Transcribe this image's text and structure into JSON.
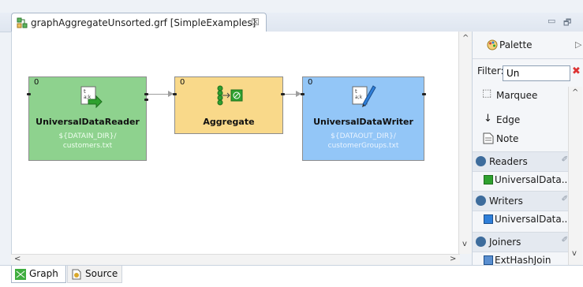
{
  "editor": {
    "tab_title": "graphAggregateUnsorted.grf [SimpleExamples]",
    "tab_close": "☒",
    "minimize": "▭",
    "maximize": "🗗"
  },
  "graph": {
    "reader": {
      "index": "0",
      "title": "UniversalDataReader",
      "sub1": "${DATAIN_DIR}/",
      "sub2": "customers.txt",
      "color": "#8ed28e"
    },
    "aggregate": {
      "index": "0",
      "title": "Aggregate",
      "color": "#f9d98a"
    },
    "writer": {
      "index": "0",
      "title": "UniversalDataWriter",
      "sub1": "${DATAOUT_DIR}/",
      "sub2": "customerGroups.txt",
      "color": "#93c6f7"
    }
  },
  "palette": {
    "title": "Palette",
    "expand": "▷",
    "filter_label": "Filter:",
    "filter_value": "Un",
    "marquee": "Marquee",
    "edge": "Edge",
    "note": "Note",
    "readers_label": "Readers",
    "readers_item": "UniversalData...",
    "writers_label": "Writers",
    "writers_item": "UniversalData...",
    "joiners_label": "Joiners",
    "joiners_item": "ExtHashJoin"
  },
  "bottom_tabs": {
    "graph": "Graph",
    "source": "Source"
  },
  "scroll": {
    "up": "^",
    "down": "v",
    "left": "<",
    "right": ">"
  }
}
